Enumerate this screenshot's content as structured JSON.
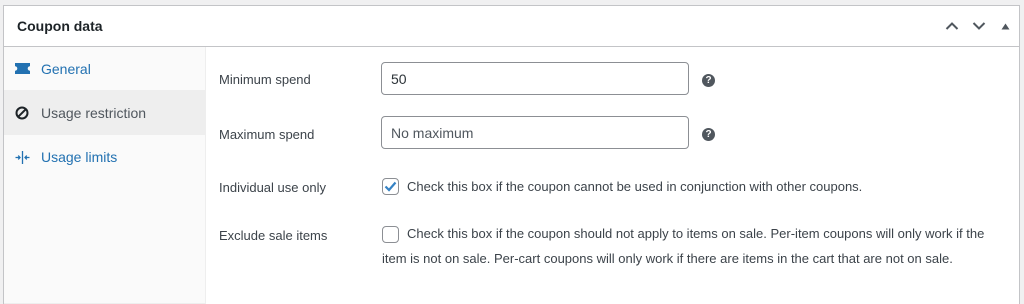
{
  "panel": {
    "title": "Coupon data"
  },
  "tabs": [
    {
      "label": "General",
      "icon": "ticket-icon",
      "active": false
    },
    {
      "label": "Usage restriction",
      "icon": "circle-slash-icon",
      "active": true
    },
    {
      "label": "Usage limits",
      "icon": "arrows-limit-icon",
      "active": false
    }
  ],
  "fields": {
    "minimum_spend": {
      "label": "Minimum spend",
      "value": "50",
      "placeholder": ""
    },
    "maximum_spend": {
      "label": "Maximum spend",
      "value": "",
      "placeholder": "No maximum"
    },
    "individual_use": {
      "label": "Individual use only",
      "checked": true,
      "description": "Check this box if the coupon cannot be used in conjunction with other coupons."
    },
    "exclude_sale": {
      "label": "Exclude sale items",
      "checked": false,
      "description": "Check this box if the coupon should not apply to items on sale. Per-item coupons will only work if the item is not on sale. Per-cart coupons will only work if there are items in the cart that are not on sale."
    }
  },
  "help_icon": "?",
  "colors": {
    "link": "#2271b1",
    "checkmark": "#3582c4"
  }
}
